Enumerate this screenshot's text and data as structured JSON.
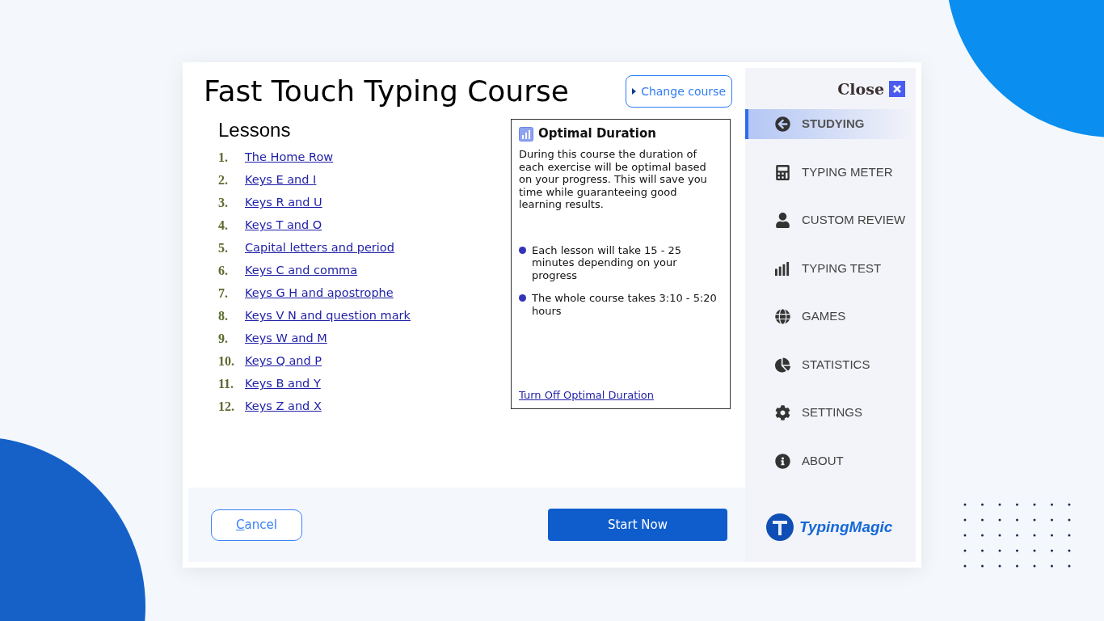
{
  "title": "Fast Touch Typing Course",
  "change_course": {
    "label": "Change course"
  },
  "lessons": {
    "heading": "Lessons",
    "items": [
      {
        "number": "1.",
        "title": "The Home Row"
      },
      {
        "number": "2.",
        "title": "Keys E and I"
      },
      {
        "number": "3.",
        "title": "Keys R and U"
      },
      {
        "number": "4.",
        "title": "Keys T and O"
      },
      {
        "number": "5.",
        "title": "Capital letters and period"
      },
      {
        "number": "6.",
        "title": "Keys C and comma"
      },
      {
        "number": "7.",
        "title": "Keys G H and apostrophe"
      },
      {
        "number": "8.",
        "title": "Keys V N and question mark"
      },
      {
        "number": "9.",
        "title": "Keys W and M"
      },
      {
        "number": "10.",
        "title": "Keys Q and P"
      },
      {
        "number": "11.",
        "title": "Keys B and Y"
      },
      {
        "number": "12.",
        "title": "Keys Z and X"
      }
    ]
  },
  "info_box": {
    "title": "Optimal Duration",
    "description": "During this course the duration of each exercise will be optimal based on your progress. This will save you time while guaranteeing good learning results.",
    "bullets": [
      "Each lesson will take 15 - 25 minutes depending on your progress",
      "The whole course takes 3:10 - 5:20 hours"
    ],
    "link": "Turn Off Optimal Duration"
  },
  "footer": {
    "cancel": {
      "accelerator": "C",
      "rest": "ancel"
    },
    "start": "Start Now"
  },
  "sidebar": {
    "close": "Close",
    "items": [
      {
        "kind": "back",
        "label": "STUDYING",
        "selected": true
      },
      {
        "kind": "calculator",
        "label": "TYPING METER",
        "selected": false
      },
      {
        "kind": "person",
        "label": "CUSTOM REVIEW",
        "selected": false
      },
      {
        "kind": "bars",
        "label": "TYPING TEST",
        "selected": false
      },
      {
        "kind": "globe",
        "label": "GAMES",
        "selected": false
      },
      {
        "kind": "pie",
        "label": "STATISTICS",
        "selected": false
      },
      {
        "kind": "gear",
        "label": "SETTINGS",
        "selected": false
      },
      {
        "kind": "info",
        "label": "ABOUT",
        "selected": false
      }
    ],
    "brand": "TypingMagic"
  }
}
